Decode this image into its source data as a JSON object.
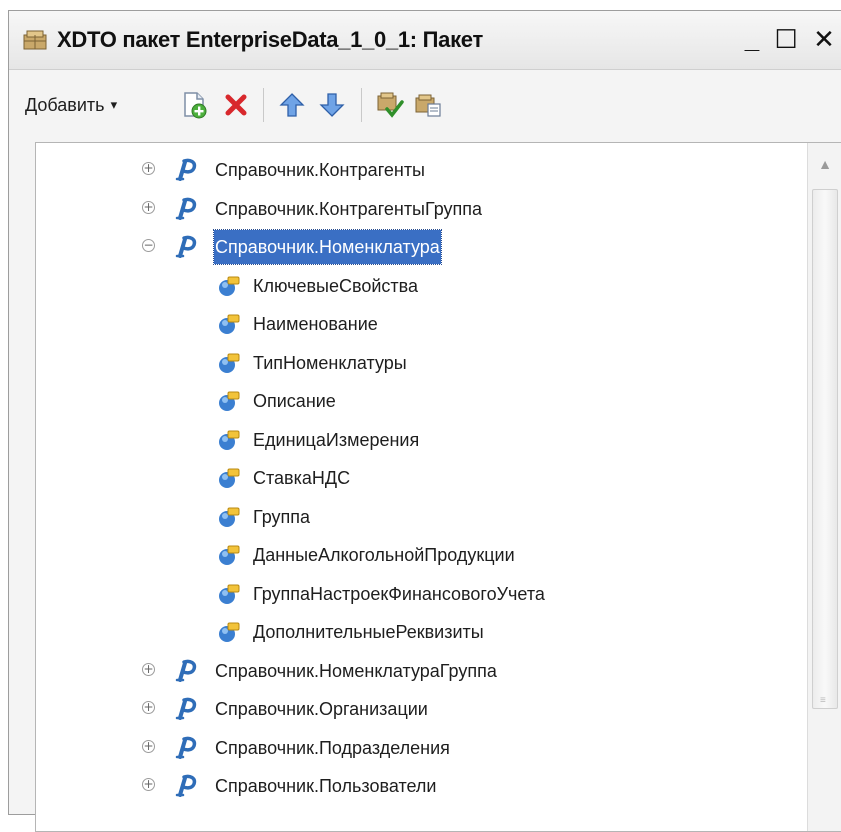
{
  "window": {
    "title": "XDTO пакет EnterpriseData_1_0_1: Пакет",
    "minimize": "_",
    "maximize": "☐",
    "close": "✕"
  },
  "toolbar": {
    "add_label": "Добавить",
    "caret": "▾"
  },
  "tree": {
    "rows": [
      {
        "label": "Справочник.Контрагенты",
        "kind": "package",
        "expander": "⊕"
      },
      {
        "label": "Справочник.КонтрагентыГруппа",
        "kind": "package",
        "expander": "⊕"
      },
      {
        "label": "Справочник.Номенклатура",
        "kind": "package",
        "expander": "⊖",
        "selected": true
      },
      {
        "label": "КлючевыеСвойства",
        "kind": "property"
      },
      {
        "label": "Наименование",
        "kind": "property"
      },
      {
        "label": "ТипНоменклатуры",
        "kind": "property"
      },
      {
        "label": "Описание",
        "kind": "property"
      },
      {
        "label": "ЕдиницаИзмерения",
        "kind": "property"
      },
      {
        "label": "СтавкаНДС",
        "kind": "property"
      },
      {
        "label": "Группа",
        "kind": "property"
      },
      {
        "label": "ДанныеАлкогольнойПродукции",
        "kind": "property"
      },
      {
        "label": "ГруппаНастроекФинансовогоУчета",
        "kind": "property"
      },
      {
        "label": "ДополнительныеРеквизиты",
        "kind": "property"
      },
      {
        "label": "Справочник.НоменклатураГруппа",
        "kind": "package",
        "expander": "⊕"
      },
      {
        "label": "Справочник.Организации",
        "kind": "package",
        "expander": "⊕"
      },
      {
        "label": "Справочник.Подразделения",
        "kind": "package",
        "expander": "⊕"
      },
      {
        "label": "Справочник.Пользователи",
        "kind": "package",
        "expander": "⊕"
      }
    ]
  },
  "scrollbar": {
    "up_arrow": "▲",
    "grip": "≡"
  },
  "icons": {
    "title": "package-window-icon",
    "add_item": "add-document-icon",
    "delete": "delete-x-icon",
    "move_up": "arrow-up-icon",
    "move_down": "arrow-down-icon",
    "check": "check-icon",
    "export": "export-icon",
    "package_node": "xdto-package-icon",
    "property_node": "property-icon"
  },
  "colors": {
    "selection": "#3a6fc4",
    "package_icon": "#2f6db8",
    "property_icon_blue": "#3b7fd1",
    "property_icon_yellow": "#f2c33a",
    "delete_red": "#d8282c",
    "arrow_blue": "#4a86d8"
  }
}
